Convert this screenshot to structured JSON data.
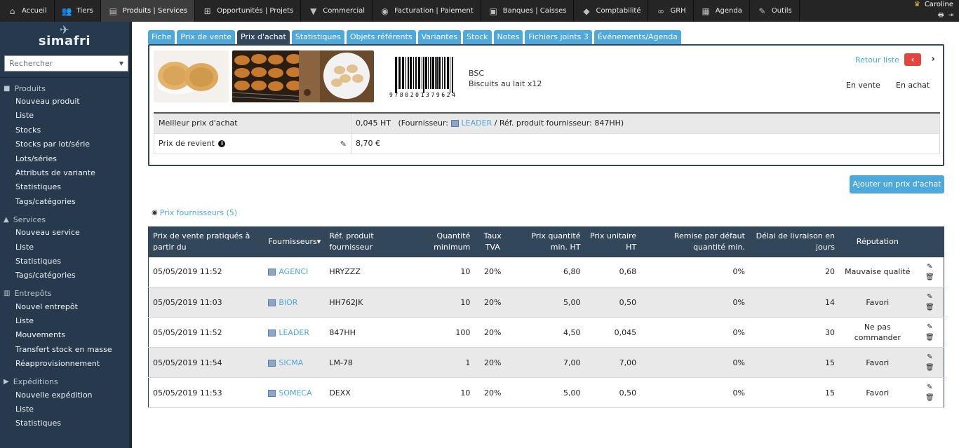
{
  "topnav": [
    {
      "label": "Accueil",
      "icon": "home-icon",
      "glyph": "⌂"
    },
    {
      "label": "Tiers",
      "icon": "users-icon",
      "glyph": "👥"
    },
    {
      "label": "Produits | Services",
      "icon": "box-icon",
      "glyph": "▤",
      "active": true
    },
    {
      "label": "Opportunités | Projets",
      "icon": "sitemap-icon",
      "glyph": "⊞"
    },
    {
      "label": "Commercial",
      "icon": "tie-icon",
      "glyph": "▼"
    },
    {
      "label": "Facturation | Paiement",
      "icon": "piggy-bank-icon",
      "glyph": "◉"
    },
    {
      "label": "Banques | Caisses",
      "icon": "bank-icon",
      "glyph": "▣"
    },
    {
      "label": "Comptabilité",
      "icon": "car-icon",
      "glyph": "◆"
    },
    {
      "label": "GRH",
      "icon": "glasses-icon",
      "glyph": "∞"
    },
    {
      "label": "Agenda",
      "icon": "calendar-icon",
      "glyph": "▦"
    },
    {
      "label": "Outils",
      "icon": "wrench-icon",
      "glyph": "✎"
    }
  ],
  "user": {
    "name": "Caroline",
    "print_icon": "🖶",
    "logout_icon": "⇥"
  },
  "brand": {
    "name": "simafri"
  },
  "search": {
    "placeholder": "Rechercher"
  },
  "sidebar": [
    {
      "title": "Produits",
      "icon": "box-icon",
      "glyph": "■",
      "items": [
        "Nouveau produit",
        "Liste",
        "Stocks",
        "Stocks par lot/série",
        "Lots/séries",
        "Attributs de variante",
        "Statistiques",
        "Tags/catégories"
      ]
    },
    {
      "title": "Services",
      "icon": "ship-icon",
      "glyph": "▲",
      "items": [
        "Nouveau service",
        "Liste",
        "Statistiques",
        "Tags/catégories"
      ]
    },
    {
      "title": "Entrepôts",
      "icon": "warehouse-icon",
      "glyph": "▥",
      "items": [
        "Nouvel entrepôt",
        "Liste",
        "Mouvements",
        "Transfert stock en masse",
        "Réapprovisionnement"
      ]
    },
    {
      "title": "Expéditions",
      "icon": "truck-icon",
      "glyph": "▶",
      "items": [
        "Nouvelle expédition",
        "Liste",
        "Statistiques"
      ]
    }
  ],
  "tabs": [
    "Fiche",
    "Prix de vente",
    "Prix d'achat",
    "Statistiques",
    "Objets référents",
    "Variantes",
    "Stock",
    "Notes",
    "Fichiers joints 3",
    "Événements/Agenda"
  ],
  "active_tab": "Prix d'achat",
  "product": {
    "ref": "BSC",
    "label": "Biscuits au lait x12",
    "barcode_digits": "9780201379624",
    "back_link": "Retour liste",
    "prev": "‹",
    "next": "›",
    "status_sale": "En vente",
    "status_buy": "En achat"
  },
  "best_price": {
    "label": "Meilleur prix d'achat",
    "value": "0,045 HT",
    "supplier_prefix": "(Fournisseur:",
    "supplier": "LEADER",
    "supplier_ref_text": "/ Réf. produit fournisseur: 847HH)"
  },
  "cost_price": {
    "label": "Prix de revient",
    "value": "8,70 €"
  },
  "add_button": "Ajouter un prix d'achat",
  "supplier_prices_link": "Prix fournisseurs (5)",
  "table": {
    "headers": [
      "Prix de vente pratiqués à partir du",
      "Fournisseurs▾",
      "Réf. produit fournisseur",
      "Quantité minimum",
      "Taux TVA",
      "Prix quantité min. HT",
      "Prix unitaire HT",
      "Remise par défaut quantité min.",
      "Délai de livraison en jours",
      "Réputation"
    ],
    "rows": [
      {
        "date": "05/05/2019 11:52",
        "supplier": "AGENCI",
        "ref": "HRYZZZ",
        "qty": "10",
        "vat": "20%",
        "price_qty": "6,80",
        "unit": "0,68",
        "discount": "0%",
        "delay": "20",
        "reputation": "Mauvaise qualité"
      },
      {
        "date": "05/05/2019 11:03",
        "supplier": "BIOR",
        "ref": "HH762JK",
        "qty": "10",
        "vat": "20%",
        "price_qty": "5,00",
        "unit": "0,50",
        "discount": "0%",
        "delay": "14",
        "reputation": "Favori"
      },
      {
        "date": "05/05/2019 11:52",
        "supplier": "LEADER",
        "ref": "847HH",
        "qty": "100",
        "vat": "20%",
        "price_qty": "4,50",
        "unit": "0,045",
        "discount": "0%",
        "delay": "30",
        "reputation": "Ne pas commander"
      },
      {
        "date": "05/05/2019 11:54",
        "supplier": "SICMA",
        "ref": "LM-78",
        "qty": "1",
        "vat": "20%",
        "price_qty": "7,00",
        "unit": "7,00",
        "discount": "0%",
        "delay": "15",
        "reputation": "Favori"
      },
      {
        "date": "05/05/2019 11:53",
        "supplier": "SOMECA",
        "ref": "DEXX",
        "qty": "10",
        "vat": "20%",
        "price_qty": "5,00",
        "unit": "0,50",
        "discount": "0%",
        "delay": "15",
        "reputation": "Favori"
      }
    ]
  },
  "colors": {
    "accent": "#4fa8dc",
    "header": "#33475b",
    "sidebar": "#273a4d",
    "topbar": "#252525",
    "danger": "#e4443f"
  }
}
